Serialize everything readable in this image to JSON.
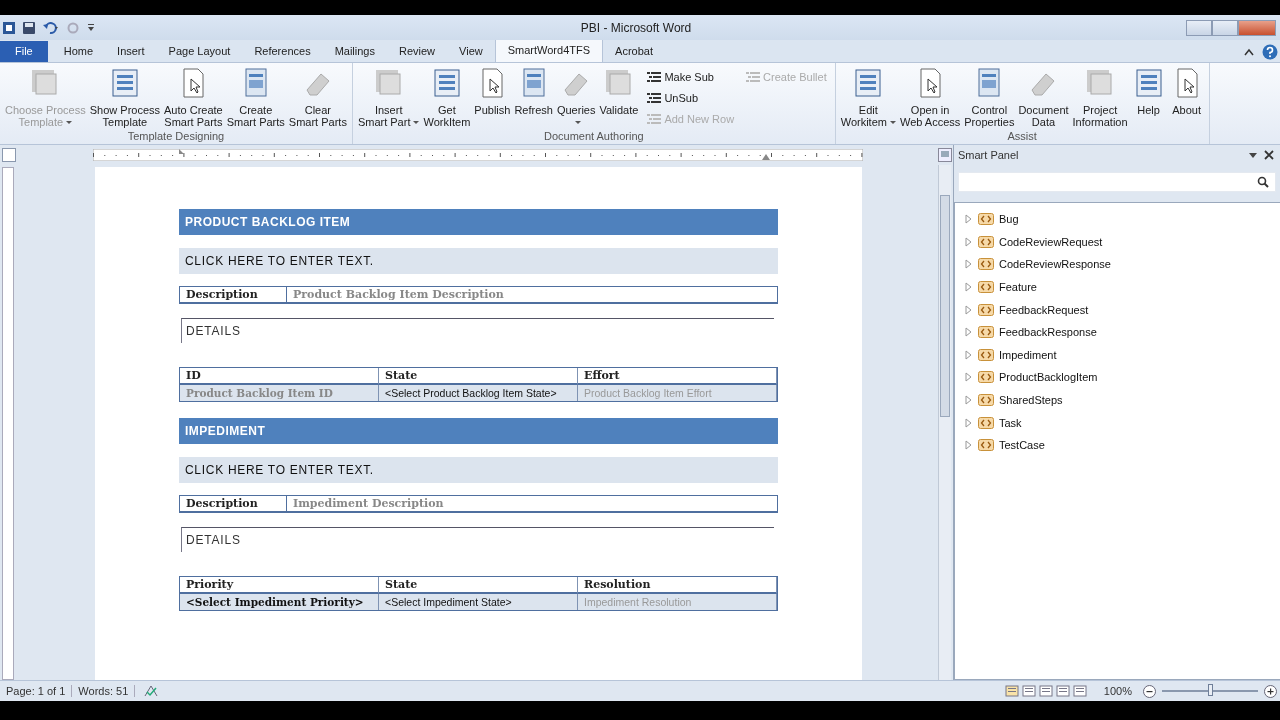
{
  "window": {
    "title": "PBI - Microsoft Word"
  },
  "tabs": [
    {
      "label": "File",
      "kind": "file",
      "selected": false
    },
    {
      "label": "Home",
      "kind": "tab",
      "selected": false
    },
    {
      "label": "Insert",
      "kind": "tab",
      "selected": false
    },
    {
      "label": "Page Layout",
      "kind": "tab",
      "selected": false
    },
    {
      "label": "References",
      "kind": "tab",
      "selected": false
    },
    {
      "label": "Mailings",
      "kind": "tab",
      "selected": false
    },
    {
      "label": "Review",
      "kind": "tab",
      "selected": false
    },
    {
      "label": "View",
      "kind": "tab",
      "selected": false
    },
    {
      "label": "SmartWord4TFS",
      "kind": "tab",
      "selected": true
    },
    {
      "label": "Acrobat",
      "kind": "tab",
      "selected": false
    }
  ],
  "ribbon": {
    "groups": [
      {
        "label": "Template Designing",
        "buttons": [
          {
            "kind": "large",
            "lines": [
              "Choose Process",
              "Template"
            ],
            "disabled": true,
            "dropdown": true
          },
          {
            "kind": "large",
            "lines": [
              "Show Process",
              "Template"
            ],
            "disabled": false,
            "dropdown": false
          },
          {
            "kind": "large",
            "lines": [
              "Auto Create",
              "Smart Parts"
            ],
            "disabled": false,
            "dropdown": false
          },
          {
            "kind": "large",
            "lines": [
              "Create",
              "Smart Parts"
            ],
            "disabled": false,
            "dropdown": false
          },
          {
            "kind": "large",
            "lines": [
              "Clear",
              "Smart Parts"
            ],
            "disabled": false,
            "dropdown": false
          }
        ]
      },
      {
        "label": "Document Authoring",
        "buttons": [
          {
            "kind": "large",
            "lines": [
              "Insert",
              "Smart Part"
            ],
            "disabled": false,
            "dropdown": true
          },
          {
            "kind": "large",
            "lines": [
              "Get",
              "WorkItem"
            ],
            "disabled": false,
            "dropdown": false
          },
          {
            "kind": "large",
            "lines": [
              "Publish"
            ],
            "disabled": false,
            "dropdown": false
          },
          {
            "kind": "large",
            "lines": [
              "Refresh"
            ],
            "disabled": false,
            "dropdown": false
          },
          {
            "kind": "large",
            "lines": [
              "Queries"
            ],
            "disabled": false,
            "dropdown": true
          },
          {
            "kind": "large",
            "lines": [
              "Validate"
            ],
            "disabled": false,
            "dropdown": false
          },
          {
            "kind": "small",
            "lines": [
              "Make Sub"
            ],
            "disabled": false,
            "dropdown": false
          },
          {
            "kind": "small",
            "lines": [
              "UnSub"
            ],
            "disabled": false,
            "dropdown": false
          },
          {
            "kind": "small",
            "lines": [
              "Add New Row"
            ],
            "disabled": true,
            "dropdown": false
          },
          {
            "kind": "small",
            "lines": [
              "Create Bullet"
            ],
            "disabled": true,
            "dropdown": false
          }
        ]
      },
      {
        "label": "Assist",
        "buttons": [
          {
            "kind": "large",
            "lines": [
              "Edit",
              "Workitem"
            ],
            "disabled": false,
            "dropdown": true
          },
          {
            "kind": "large",
            "lines": [
              "Open in",
              "Web Access"
            ],
            "disabled": false,
            "dropdown": false
          },
          {
            "kind": "large",
            "lines": [
              "Control",
              "Properties"
            ],
            "disabled": false,
            "dropdown": false
          },
          {
            "kind": "large",
            "lines": [
              "Document",
              "Data"
            ],
            "disabled": false,
            "dropdown": false
          },
          {
            "kind": "large",
            "lines": [
              "Project",
              "Information"
            ],
            "disabled": false,
            "dropdown": false
          },
          {
            "kind": "large",
            "lines": [
              "Help"
            ],
            "disabled": false,
            "dropdown": false
          },
          {
            "kind": "large",
            "lines": [
              "About"
            ],
            "disabled": false,
            "dropdown": false
          }
        ]
      }
    ]
  },
  "document": {
    "sections": [
      {
        "header": "PRODUCT BACKLOG ITEM",
        "placeholder": "CLICK HERE TO ENTER TEXT.",
        "description": {
          "label": "Description",
          "value": "Product Backlog Item Description"
        },
        "details": "DETAILS",
        "table": {
          "columns": [
            "ID",
            "State",
            "Effort"
          ],
          "cells": [
            {
              "text": "Product Backlog Item ID",
              "kind": "placeholder-serif"
            },
            {
              "text": "<Select Product Backlog Item State>",
              "kind": "select"
            },
            {
              "text": "Product Backlog Item Effort",
              "kind": "placeholder-sans"
            }
          ]
        }
      },
      {
        "header": "IMPEDIMENT",
        "placeholder": "CLICK HERE TO ENTER TEXT.",
        "description": {
          "label": "Description",
          "value": "Impediment Description"
        },
        "details": "DETAILS",
        "table": {
          "columns": [
            "Priority",
            "State",
            "Resolution"
          ],
          "cells": [
            {
              "text": "<Select Impediment Priority>",
              "kind": "select-bold"
            },
            {
              "text": "<Select Impediment State>",
              "kind": "select"
            },
            {
              "text": "Impediment Resolution",
              "kind": "placeholder-sans"
            }
          ]
        }
      }
    ]
  },
  "smart_panel": {
    "title": "Smart Panel",
    "items": [
      {
        "label": "Bug",
        "expanded": false
      },
      {
        "label": "CodeReviewRequest",
        "expanded": false
      },
      {
        "label": "CodeReviewResponse",
        "expanded": false
      },
      {
        "label": "Feature",
        "expanded": false
      },
      {
        "label": "FeedbackRequest",
        "expanded": false
      },
      {
        "label": "FeedbackResponse",
        "expanded": false
      },
      {
        "label": "Impediment",
        "expanded": false
      },
      {
        "label": "ProductBacklogItem",
        "expanded": false
      },
      {
        "label": "SharedSteps",
        "expanded": false
      },
      {
        "label": "Task",
        "expanded": false
      },
      {
        "label": "TestCase",
        "expanded": false
      }
    ]
  },
  "status_bar": {
    "page": "Page: 1 of 1",
    "words": "Words: 51",
    "zoom": "100%",
    "zoom_slider": {
      "level": 0.5
    }
  }
}
